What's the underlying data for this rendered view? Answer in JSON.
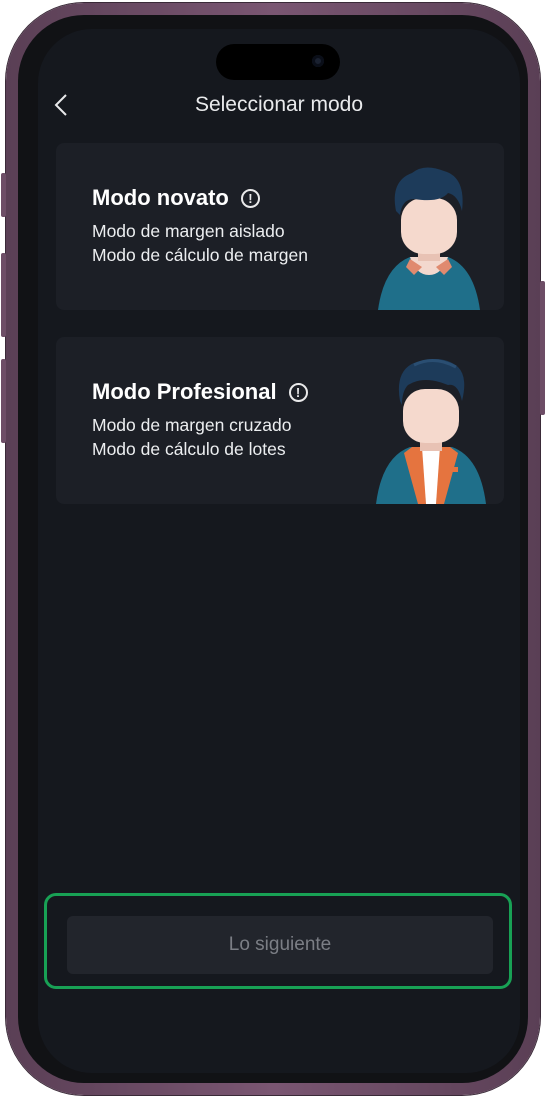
{
  "header": {
    "title": "Seleccionar modo",
    "back_icon": "chevron-left-icon"
  },
  "modes": [
    {
      "title": "Modo novato",
      "lines": [
        "Modo de margen aislado",
        "Modo de cálculo de margen"
      ],
      "icon": "info-icon"
    },
    {
      "title": "Modo Profesional",
      "lines": [
        "Modo de margen cruzado",
        "Modo de cálculo de lotes"
      ],
      "icon": "info-icon"
    }
  ],
  "footer": {
    "next_label": "Lo siguiente"
  },
  "colors": {
    "background": "#15181e",
    "card": "#1c1f26",
    "highlight": "#18a155",
    "button": "#22252c"
  }
}
